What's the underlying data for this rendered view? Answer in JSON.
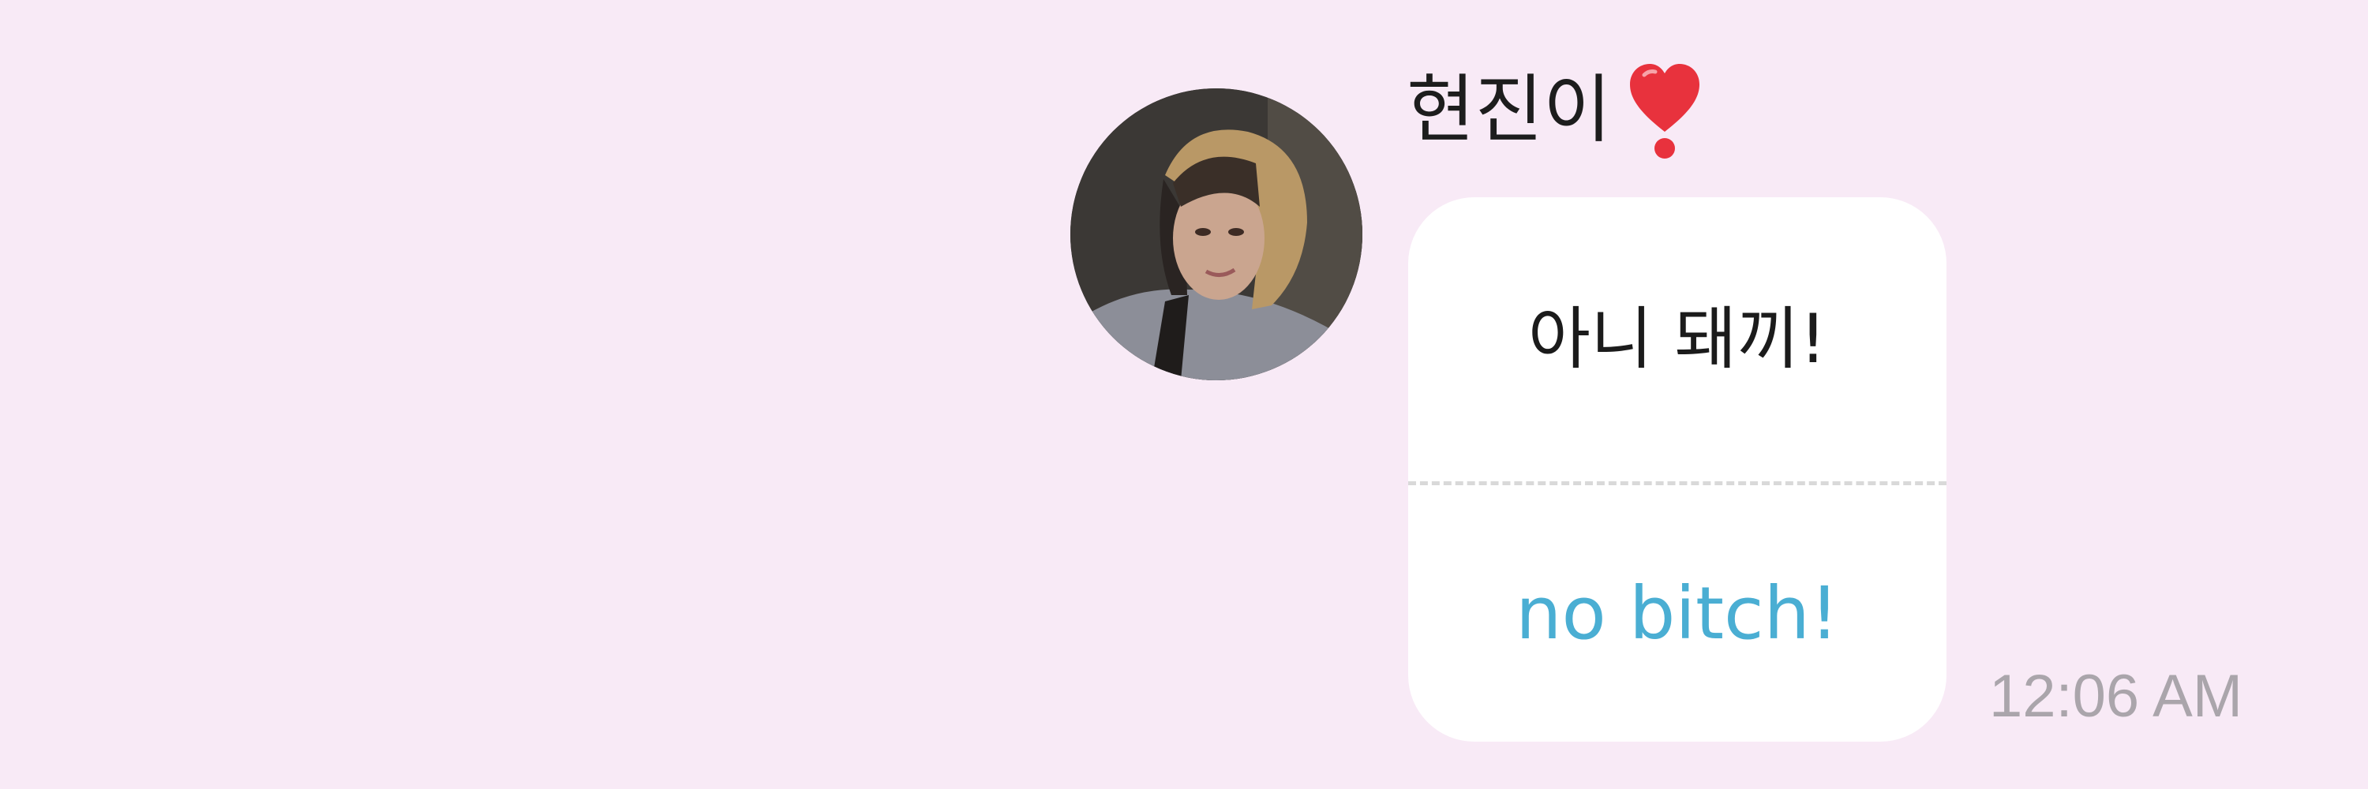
{
  "message": {
    "sender_name": "현진이",
    "sender_badge_icon": "heart-exclamation-icon",
    "original_text": "아니 돼끼!",
    "translated_text": "no bitch!",
    "timestamp": "12:06 AM"
  },
  "colors": {
    "background": "#f8eaf6",
    "bubble": "#ffffff",
    "translation_text": "#4aaed3",
    "timestamp_text": "#aaa5ab",
    "heart": "#e8323d"
  }
}
